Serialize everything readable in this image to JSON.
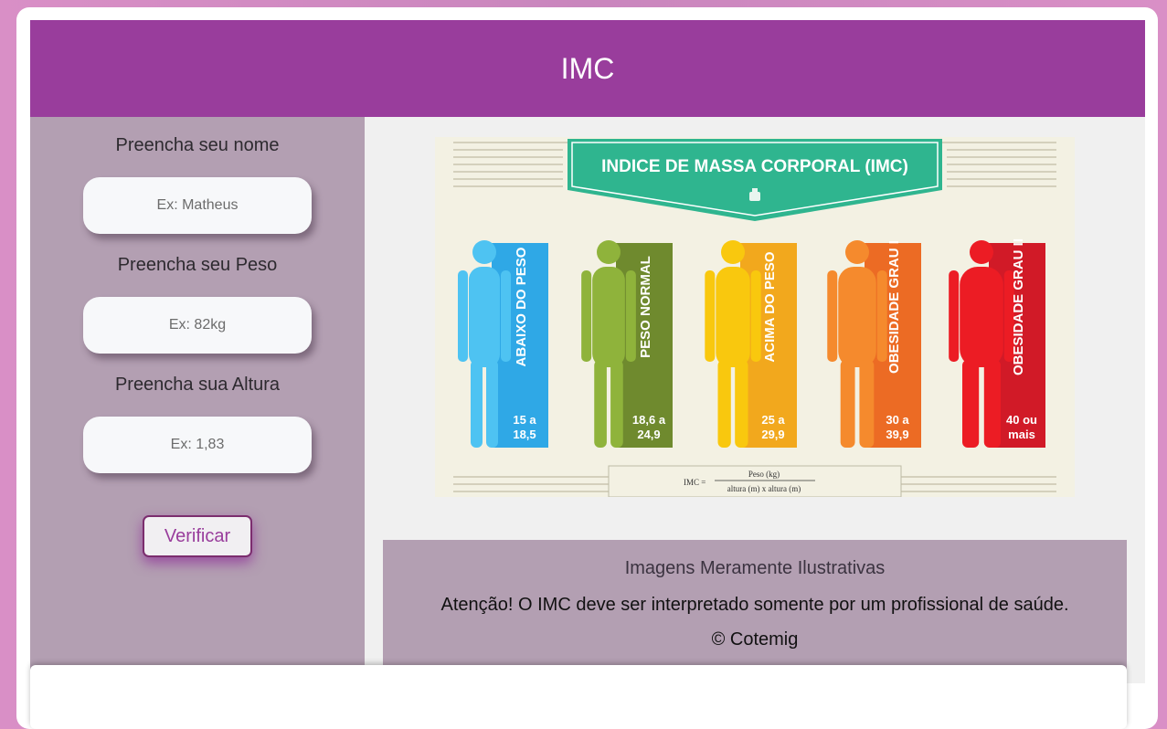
{
  "header": {
    "title": "IMC"
  },
  "form": {
    "name_label": "Preencha seu nome",
    "name_placeholder": "Ex: Matheus",
    "weight_label": "Preencha seu Peso",
    "weight_placeholder": "Ex: 82kg",
    "height_label": "Preencha sua Altura",
    "height_placeholder": "Ex: 1,83",
    "verify_button": "Verificar"
  },
  "infographic": {
    "title": "INDICE DE MASSA CORPORAL (IMC)",
    "categories": [
      {
        "label": "ABAIXO DO PESO",
        "range_line1": "15 a",
        "range_line2": "18,5",
        "color": "#2fa8e6"
      },
      {
        "label": "PESO NORMAL",
        "range_line1": "18,6 a",
        "range_line2": "24,9",
        "color": "#6f8a2e"
      },
      {
        "label": "ACIMA DO PESO",
        "range_line1": "25 a",
        "range_line2": "29,9",
        "color": "#f2a81d"
      },
      {
        "label": "OBESIDADE GRAU I",
        "range_line1": "30 a",
        "range_line2": "39,9",
        "color": "#ec6b24"
      },
      {
        "label": "OBESIDADE GRAU II",
        "range_line1": "40 ou",
        "range_line2": "mais",
        "color": "#d11a27"
      }
    ],
    "formula_left": "IMC =",
    "formula_top": "Peso (kg)",
    "formula_bottom": "altura (m) x altura (m)"
  },
  "footer": {
    "disclaimer": "Imagens Meramente Ilustrativas",
    "warning": "Atenção! O IMC deve ser interpretado somente por um profissional de saúde.",
    "copyright": "© Cotemig"
  }
}
